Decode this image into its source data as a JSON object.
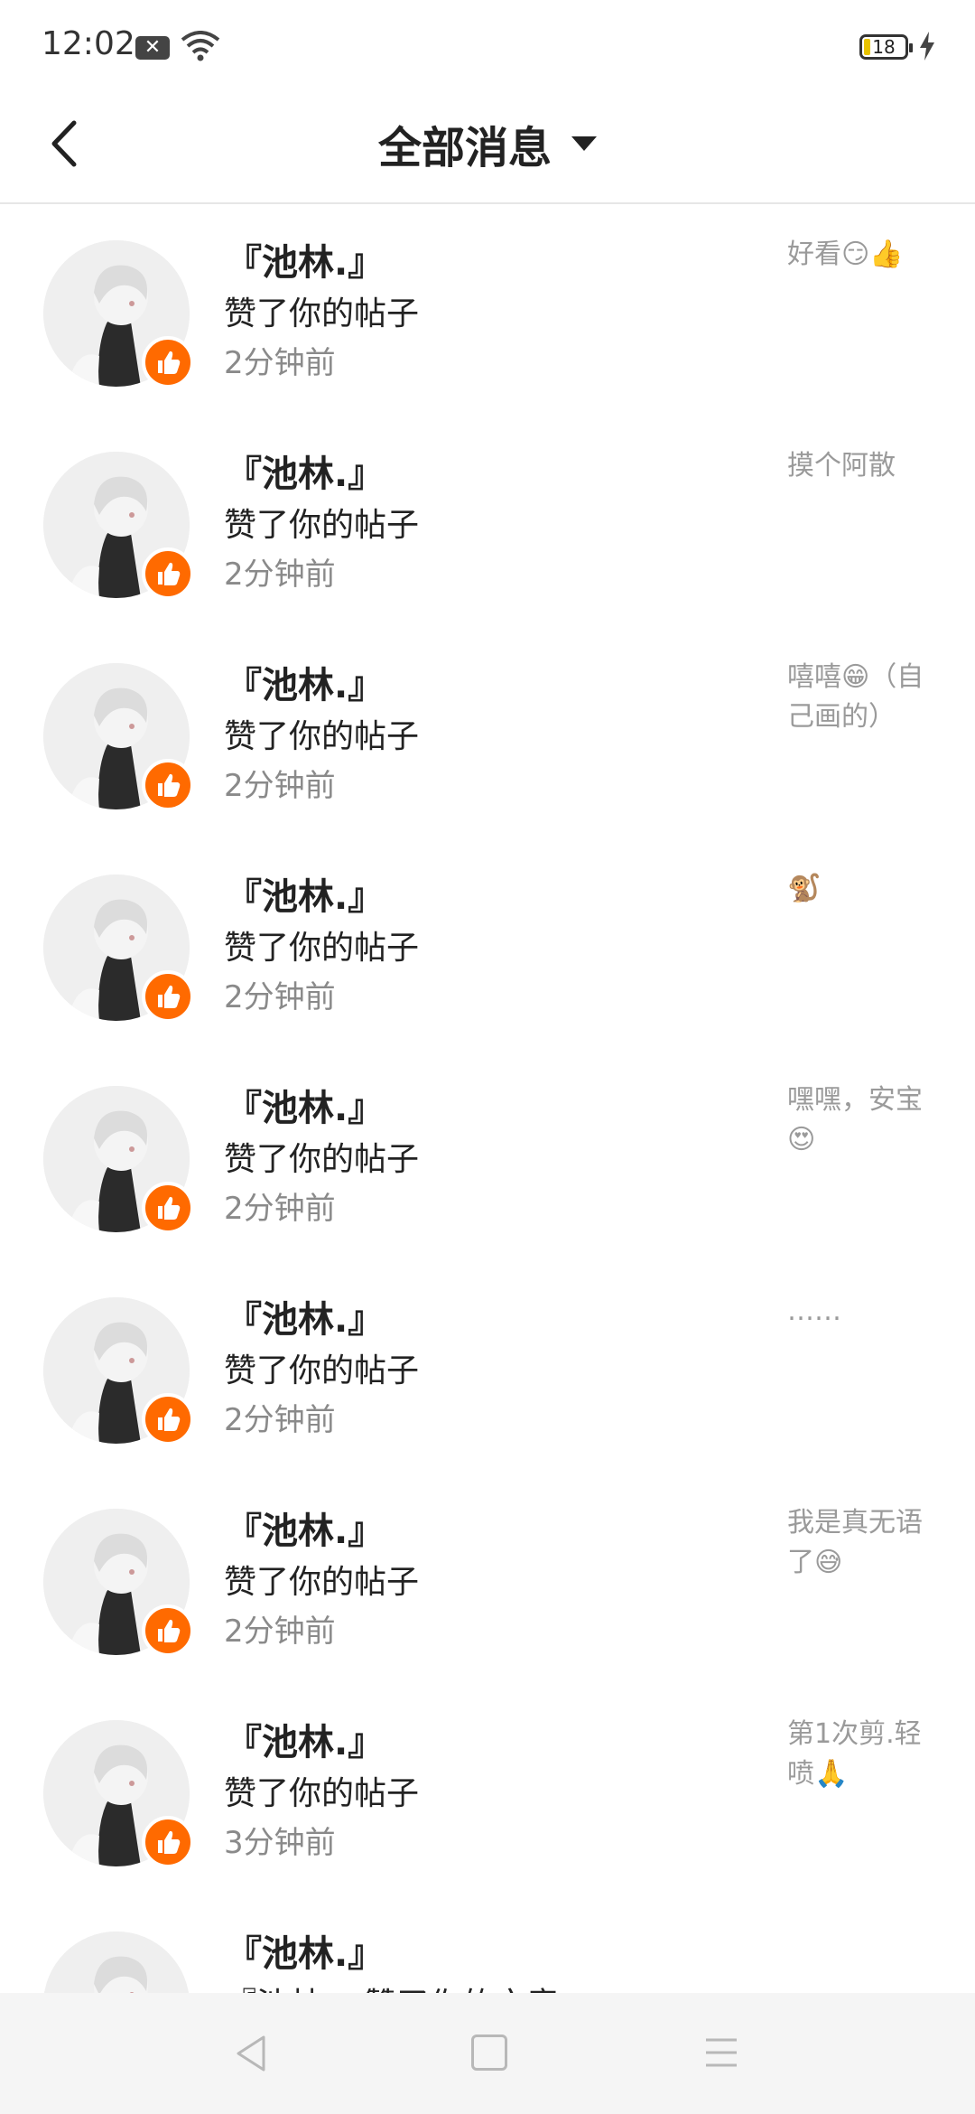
{
  "status_bar": {
    "time": "12:02",
    "notification_icon": "close-box-icon",
    "battery_level": "18",
    "wifi_icon": "wifi-icon",
    "charge_icon": "bolt-icon"
  },
  "header": {
    "back_icon": "chevron-left-icon",
    "title": "全部消息",
    "dropdown_icon": "caret-down-icon"
  },
  "colors": {
    "like_badge": "#ff6a00",
    "preview_text": "#9a9a9a",
    "time_text": "#8a8a8a"
  },
  "messages": [
    {
      "user": "『池林.』",
      "action": "赞了你的帖子",
      "time": "2分钟前",
      "preview": "好看😏👍"
    },
    {
      "user": "『池林.』",
      "action": "赞了你的帖子",
      "time": "2分钟前",
      "preview": "摸个阿散"
    },
    {
      "user": "『池林.』",
      "action": "赞了你的帖子",
      "time": "2分钟前",
      "preview": "嘻嘻😁（自己画的）"
    },
    {
      "user": "『池林.』",
      "action": "赞了你的帖子",
      "time": "2分钟前",
      "preview": "🐒"
    },
    {
      "user": "『池林.』",
      "action": "赞了你的帖子",
      "time": "2分钟前",
      "preview": "嘿嘿，安宝😍"
    },
    {
      "user": "『池林.』",
      "action": "赞了你的帖子",
      "time": "2分钟前",
      "preview": "……"
    },
    {
      "user": "『池林.』",
      "action": "赞了你的帖子",
      "time": "2分钟前",
      "preview": "我是真无语了😅"
    },
    {
      "user": "『池林.』",
      "action": "赞了你的帖子",
      "time": "3分钟前",
      "preview": "第1次剪.轻喷🙏"
    },
    {
      "user": "『池林.』",
      "action": "『池林.』赞了你的文章",
      "time": "",
      "preview": ""
    }
  ],
  "nav_bar": {
    "back_icon": "triangle-back-icon",
    "home_icon": "square-home-icon",
    "menu_icon": "three-lines-menu-icon"
  }
}
